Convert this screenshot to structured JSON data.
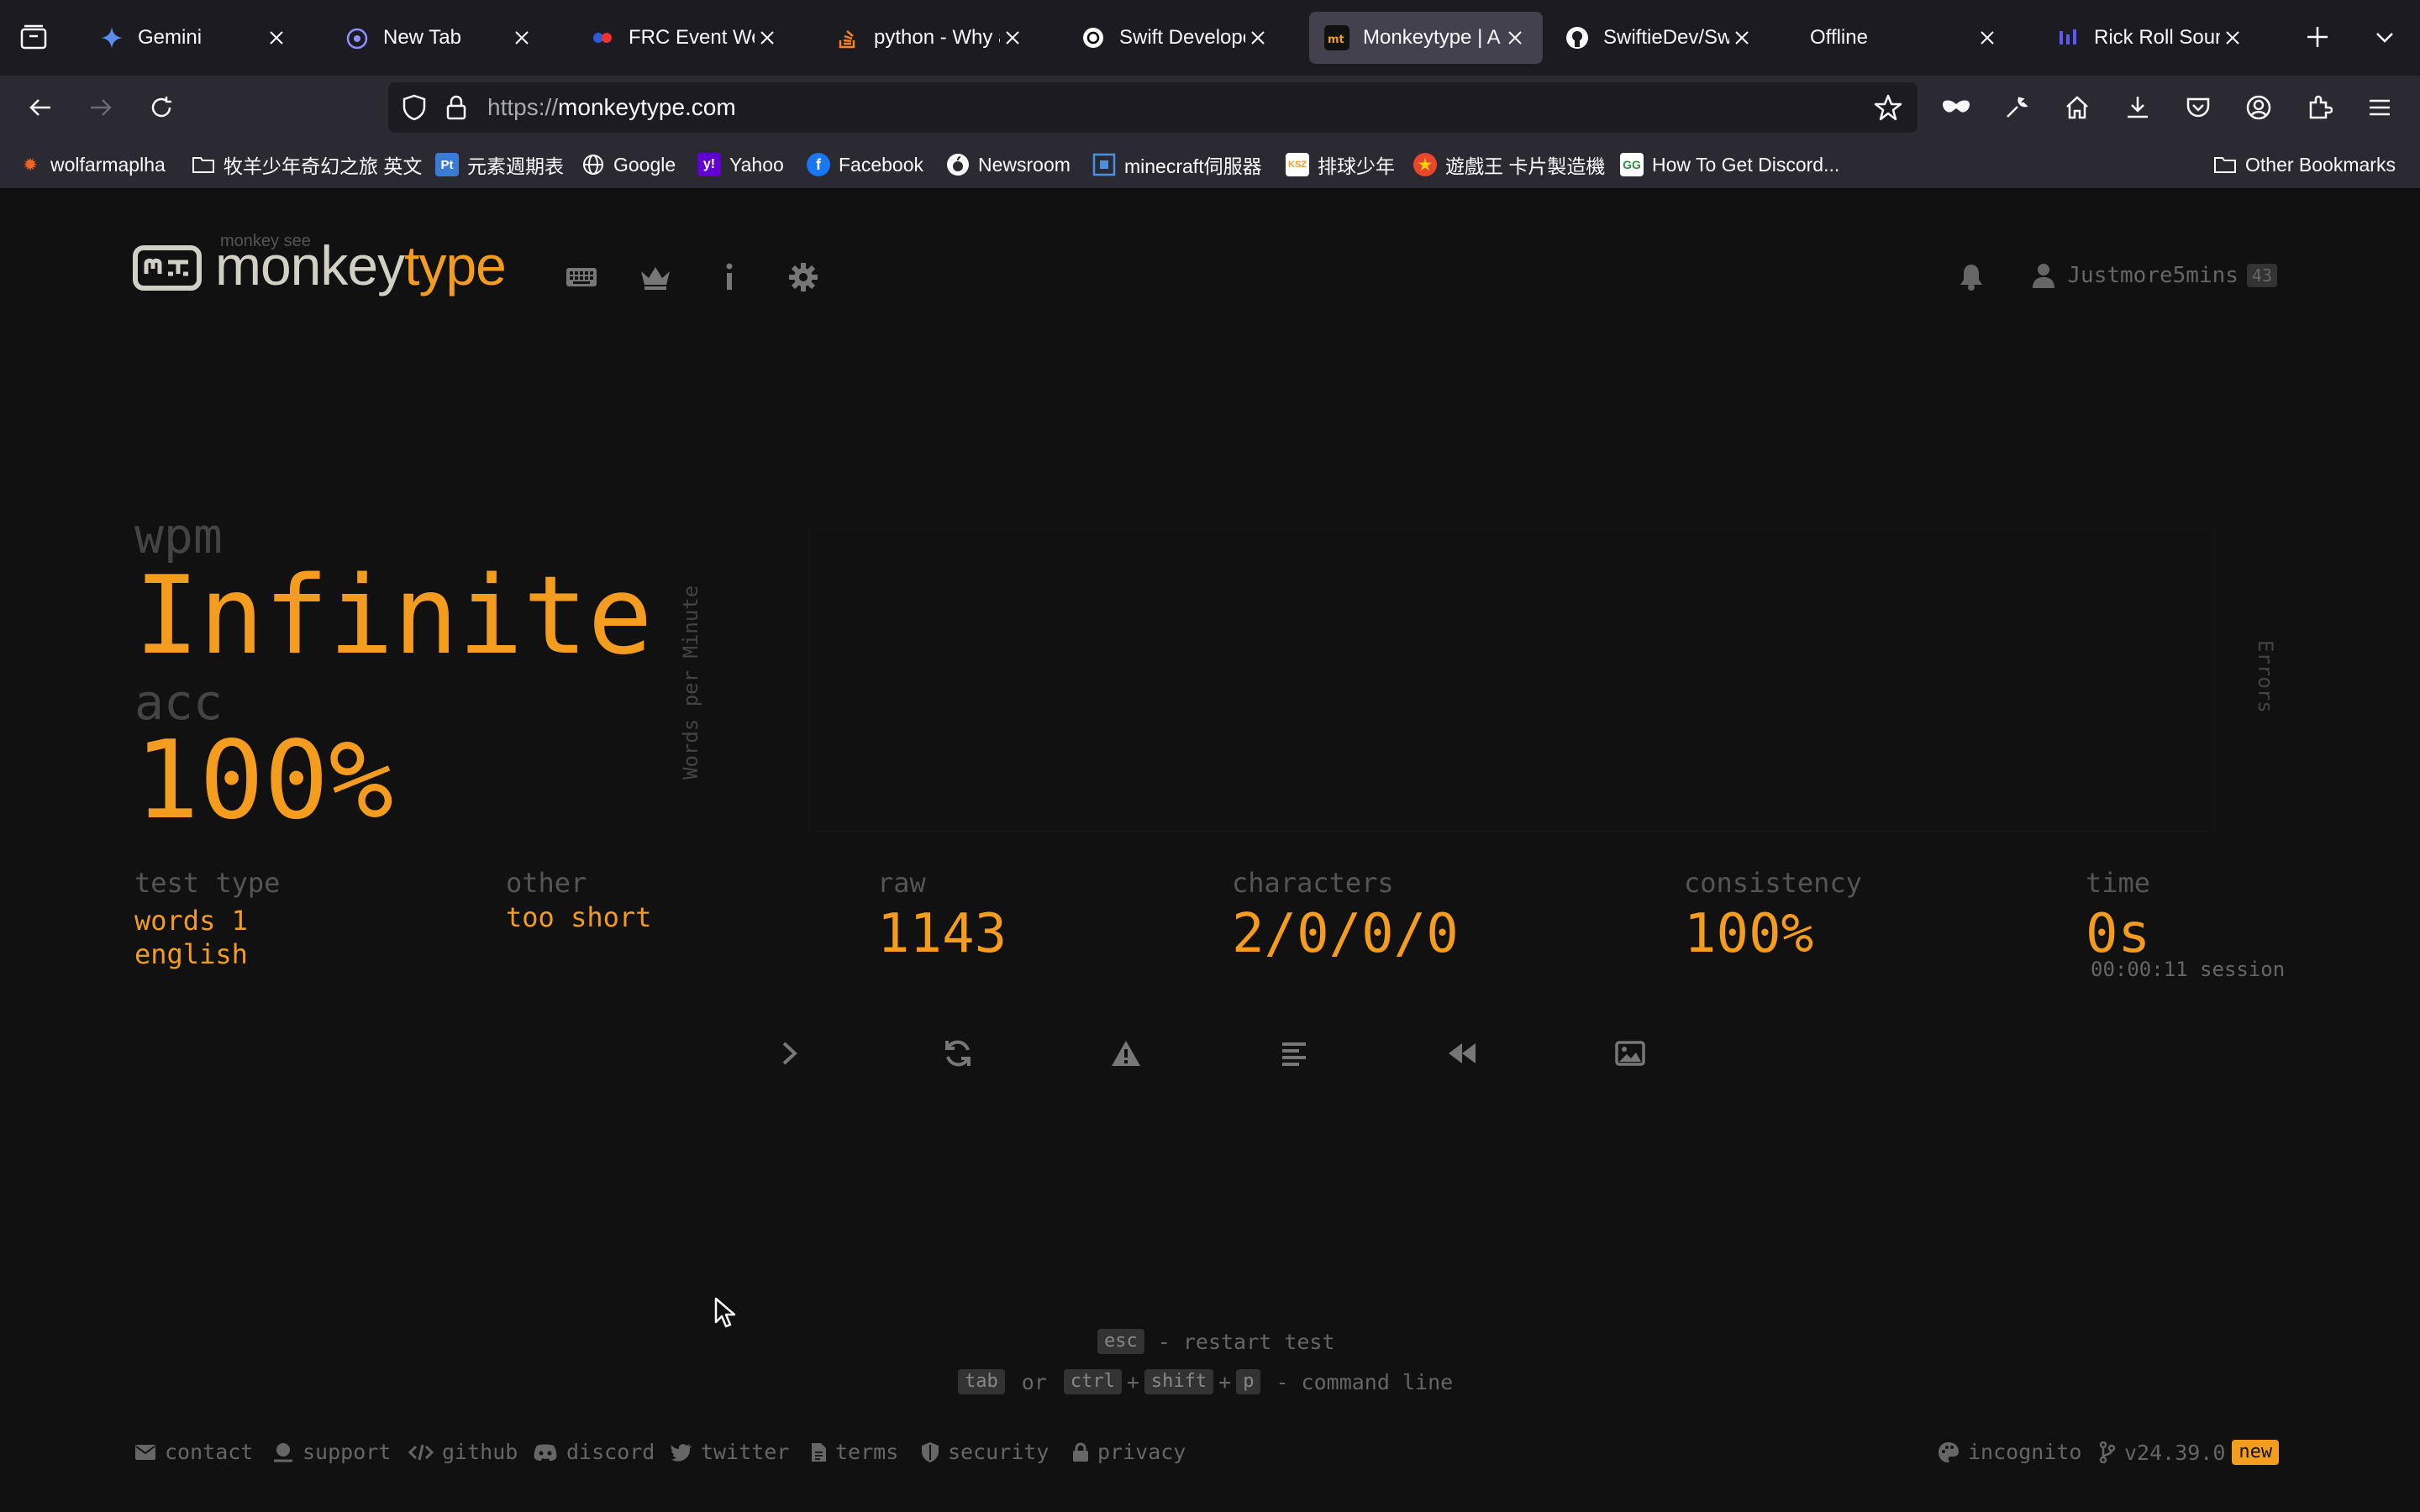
{
  "browser": {
    "tabs": [
      {
        "title": "Gemini",
        "icon": "gemini-icon"
      },
      {
        "title": "New Tab",
        "icon": "firefox-icon"
      },
      {
        "title": "FRC Event Web :",
        "icon": "frc-icon"
      },
      {
        "title": "python - Why am",
        "icon": "stackoverflow-icon"
      },
      {
        "title": "Swift Developer",
        "icon": "openai-icon"
      },
      {
        "title": "Monkeytype | A m",
        "icon": "monkeytype-icon",
        "active": true
      },
      {
        "title": "SwiftieDev/Swift",
        "icon": "github-icon"
      },
      {
        "title": "Offline",
        "icon": "none"
      },
      {
        "title": "Rick Roll Sound E",
        "icon": "audio-icon"
      }
    ],
    "url_scheme": "https://",
    "url_host": "monkeytype.com",
    "bookmarks": [
      {
        "label": "wolfarmaplha",
        "icon": "wolfram-icon"
      },
      {
        "label": "牧羊少年奇幻之旅 英文",
        "icon": "folder-icon"
      },
      {
        "label": "元素週期表",
        "icon": "pt-icon"
      },
      {
        "label": "Google",
        "icon": "globe-icon"
      },
      {
        "label": "Yahoo",
        "icon": "yahoo-icon"
      },
      {
        "label": "Facebook",
        "icon": "facebook-icon"
      },
      {
        "label": "Newsroom",
        "icon": "apple-icon"
      },
      {
        "label": "minecraft伺服器",
        "icon": "minecraft-icon"
      },
      {
        "label": "排球少年",
        "icon": "ksz-icon"
      },
      {
        "label": "遊戲王 卡片製造機",
        "icon": "yugioh-icon"
      },
      {
        "label": "How To Get Discord...",
        "icon": "gg-icon"
      }
    ],
    "other_bookmarks": "Other Bookmarks"
  },
  "header": {
    "logo_top": "monkey see",
    "logo_a": "monkey",
    "logo_b": "type",
    "username": "Justmore5mins",
    "level": "43"
  },
  "result": {
    "wpm_label": "wpm",
    "wpm_value": "Infinite",
    "acc_label": "acc",
    "acc_value": "100%",
    "chart_ylabel_left": "Words per Minute",
    "chart_ylabel_right": "Errors",
    "test_type_label": "test type",
    "test_type_line1": "words 1",
    "test_type_line2": "english",
    "other_label": "other",
    "other_value": "too short",
    "raw_label": "raw",
    "raw_value": "1143",
    "characters_label": "characters",
    "characters_value": "2/0/0/0",
    "consistency_label": "consistency",
    "consistency_value": "100%",
    "time_label": "time",
    "time_value": "0s",
    "session_value": "00:00:11 session"
  },
  "hints": {
    "esc_key": "esc",
    "esc_text": "- restart test",
    "tab_key": "tab",
    "or_text": "or",
    "ctrl_key": "ctrl",
    "plus1": "+",
    "shift_key": "shift",
    "plus2": "+",
    "p_key": "p",
    "cmd_text": "- command line"
  },
  "footer": {
    "contact": "contact",
    "support": "support",
    "github": "github",
    "discord": "discord",
    "twitter": "twitter",
    "terms": "terms",
    "security": "security",
    "privacy": "privacy",
    "theme": "incognito",
    "version": "v24.39.0",
    "new_badge": "new"
  },
  "colors": {
    "accent": "#f49c1e",
    "background": "#111111",
    "sub": "#444444"
  }
}
